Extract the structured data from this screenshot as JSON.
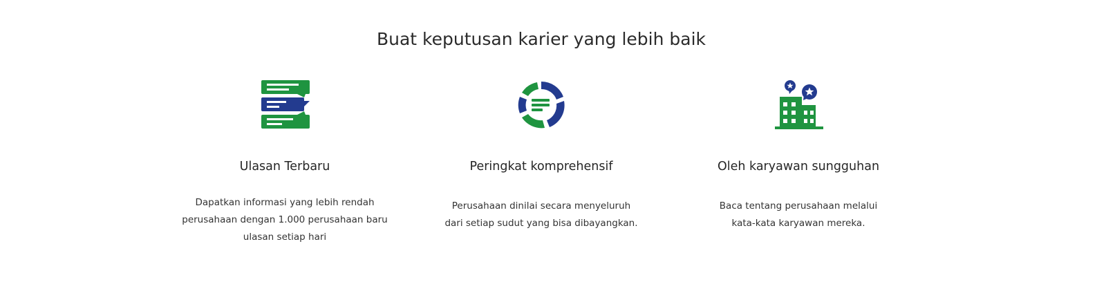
{
  "section": {
    "title": "Buat keputusan karier yang lebih baik"
  },
  "colors": {
    "green": "#1f9440",
    "blue": "#233b8f",
    "text": "#262626"
  },
  "features": [
    {
      "icon": "reviews-chat-icon",
      "title": "Ulasan Terbaru",
      "description_lines": [
        "Dapatkan informasi yang lebih rendah",
        "perusahaan dengan 1.000 perusahaan baru",
        "ulasan setiap hari"
      ]
    },
    {
      "icon": "rating-ring-icon",
      "title": "Peringkat komprehensif",
      "description_lines": [
        "Perusahaan dinilai secara menyeluruh",
        "dari setiap sudut yang bisa dibayangkan."
      ]
    },
    {
      "icon": "company-building-icon",
      "title": "Oleh karyawan sungguhan",
      "description_lines": [
        "Baca tentang perusahaan melalui",
        "kata-kata karyawan mereka."
      ]
    }
  ]
}
